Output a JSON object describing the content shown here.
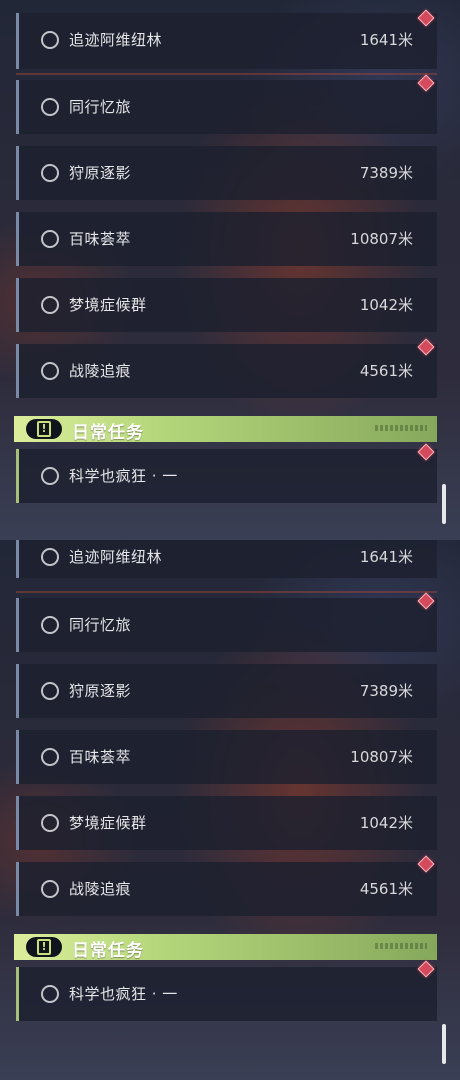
{
  "screens": [
    {
      "quests": [
        {
          "title": "追迹阿维纽林",
          "distance": "1641米"
        },
        {
          "title": "同行忆旅",
          "distance": ""
        },
        {
          "title": "狩原逐影",
          "distance": "7389米"
        },
        {
          "title": "百味荟萃",
          "distance": "10807米"
        },
        {
          "title": "梦境症候群",
          "distance": "1042米"
        },
        {
          "title": "战陵追痕",
          "distance": "4561米"
        }
      ],
      "daily_header": "日常任务",
      "daily_quest": {
        "title": "科学也疯狂 · 一"
      }
    },
    {
      "quests": [
        {
          "title": "追迹阿维纽林",
          "distance": "1641米"
        },
        {
          "title": "同行忆旅",
          "distance": ""
        },
        {
          "title": "狩原逐影",
          "distance": "7389米"
        },
        {
          "title": "百味荟萃",
          "distance": "10807米"
        },
        {
          "title": "梦境症候群",
          "distance": "1042米"
        },
        {
          "title": "战陵追痕",
          "distance": "4561米"
        }
      ],
      "daily_header": "日常任务",
      "daily_quest": {
        "title": "科学也疯狂 · 一"
      }
    }
  ],
  "header_badge_glyph": "!",
  "colors": {
    "accent_green": "#b4d67a",
    "marker_red": "#d24a5b",
    "row_border": "#7a8aa6"
  }
}
